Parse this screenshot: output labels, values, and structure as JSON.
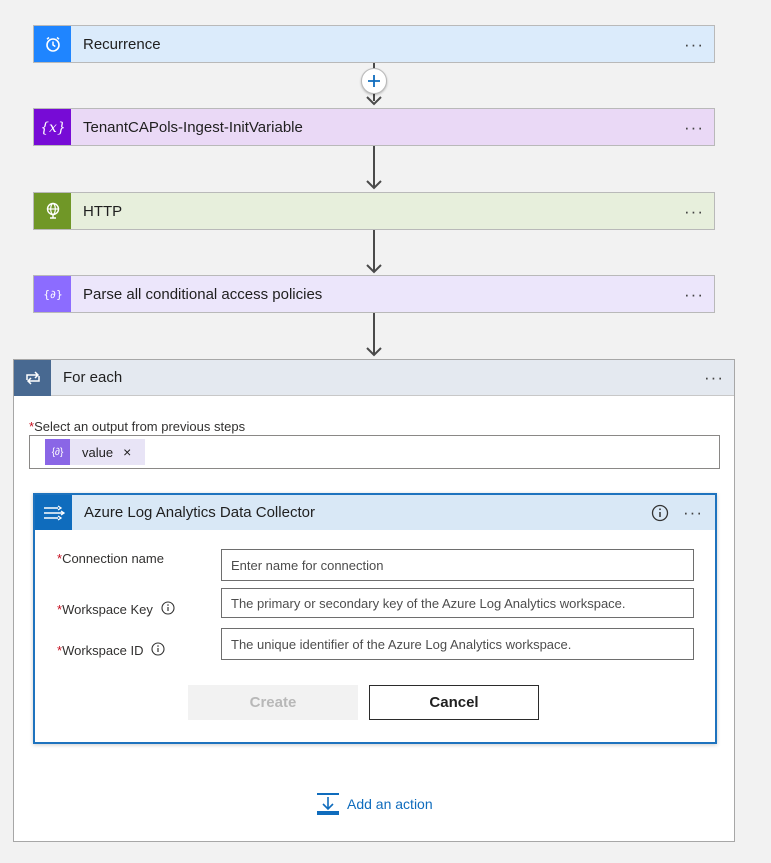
{
  "steps": [
    {
      "title": "Recurrence",
      "icon": "alarm-clock-icon",
      "color": "#1f85ff",
      "bg": "#dbebfb"
    },
    {
      "title": "TenantCAPols-Ingest-InitVariable",
      "icon": "variable-x-icon",
      "color": "#770bd6",
      "bg": "#ead9f6"
    },
    {
      "title": "HTTP",
      "icon": "globe-icon",
      "color": "#709727",
      "bg": "#e7efdc"
    },
    {
      "title": "Parse all conditional access policies",
      "icon": "data-operation-icon",
      "color": "#8c6cff",
      "bg": "#ece6fb"
    }
  ],
  "more_label": "···",
  "foreach": {
    "title": "For each",
    "output_required": "*",
    "output_label": "Select an output from previous steps",
    "token": {
      "value": "value",
      "remove": "×"
    }
  },
  "connector": {
    "title": "Azure Log Analytics Data Collector",
    "fields": [
      {
        "label": "Connection name",
        "required": "*",
        "placeholder": "Enter name for connection",
        "has_info": false
      },
      {
        "label": "Workspace Key",
        "required": "*",
        "placeholder": "The primary or secondary key of the Azure Log Analytics workspace.",
        "has_info": true
      },
      {
        "label": "Workspace ID",
        "required": "*",
        "placeholder": "The unique identifier of the Azure Log Analytics workspace.",
        "has_info": true
      }
    ],
    "create_label": "Create",
    "cancel_label": "Cancel"
  },
  "add_action_label": "Add an action",
  "colors": {
    "accent": "#0f6cbd",
    "required": "#c50f1f"
  }
}
